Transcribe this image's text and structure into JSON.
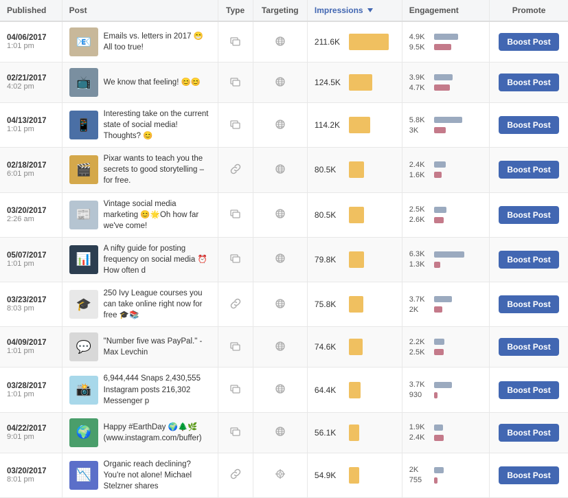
{
  "columns": {
    "published": "Published",
    "post": "Post",
    "type": "Type",
    "targeting": "Targeting",
    "impressions": "Impressions",
    "engagement": "Engagement",
    "promote": "Promote"
  },
  "boost_label": "Boost Post",
  "rows": [
    {
      "date": "04/06/2017",
      "time": "1:01 pm",
      "post_text": "Emails vs. letters in 2017 😁All too true!",
      "type": "post",
      "targeting": "public",
      "impressions_value": "211.6K",
      "impressions_pct": 100,
      "eng1_val": "4.9K",
      "eng1_pct": 78,
      "eng2_val": "9.5K",
      "eng2_pct": 55,
      "thumb_color": "#c8b89a",
      "thumb_emoji": "📧"
    },
    {
      "date": "02/21/2017",
      "time": "4:02 pm",
      "post_text": "We know that feeling! 😊😊",
      "type": "post",
      "targeting": "public",
      "impressions_value": "124.5K",
      "impressions_pct": 59,
      "eng1_val": "3.9K",
      "eng1_pct": 60,
      "eng2_val": "4.7K",
      "eng2_pct": 50,
      "thumb_color": "#7a8fa0",
      "thumb_emoji": "📺"
    },
    {
      "date": "04/13/2017",
      "time": "1:01 pm",
      "post_text": "Interesting take on the current state of social media! Thoughts? 😊",
      "type": "post",
      "targeting": "public",
      "impressions_value": "114.2K",
      "impressions_pct": 54,
      "eng1_val": "5.8K",
      "eng1_pct": 90,
      "eng2_val": "3K",
      "eng2_pct": 38,
      "thumb_color": "#4a6fa5",
      "thumb_emoji": "📱"
    },
    {
      "date": "02/18/2017",
      "time": "6:01 pm",
      "post_text": "Pixar wants to teach you the secrets to good storytelling – for free.",
      "type": "link",
      "targeting": "public",
      "impressions_value": "80.5K",
      "impressions_pct": 38,
      "eng1_val": "2.4K",
      "eng1_pct": 37,
      "eng2_val": "1.6K",
      "eng2_pct": 25,
      "thumb_color": "#d4a84b",
      "thumb_emoji": "🎬"
    },
    {
      "date": "03/20/2017",
      "time": "2:26 am",
      "post_text": "Vintage social media marketing 😊🌟Oh how far we've come!",
      "type": "post",
      "targeting": "public",
      "impressions_value": "80.5K",
      "impressions_pct": 38,
      "eng1_val": "2.5K",
      "eng1_pct": 39,
      "eng2_val": "2.6K",
      "eng2_pct": 32,
      "thumb_color": "#b5c4d1",
      "thumb_emoji": "📰"
    },
    {
      "date": "05/07/2017",
      "time": "1:01 pm",
      "post_text": "A nifty guide for posting frequency on social media ⏰How often d",
      "type": "post",
      "targeting": "public",
      "impressions_value": "79.8K",
      "impressions_pct": 38,
      "eng1_val": "6.3K",
      "eng1_pct": 98,
      "eng2_val": "1.3K",
      "eng2_pct": 20,
      "thumb_color": "#2c3e50",
      "thumb_emoji": "📊"
    },
    {
      "date": "03/23/2017",
      "time": "8:03 pm",
      "post_text": "250 Ivy League courses you can take online right now for free 🎓📚",
      "type": "link",
      "targeting": "public",
      "impressions_value": "75.8K",
      "impressions_pct": 36,
      "eng1_val": "3.7K",
      "eng1_pct": 57,
      "eng2_val": "2K",
      "eng2_pct": 27,
      "thumb_color": "#e8e8e8",
      "thumb_emoji": "🎓"
    },
    {
      "date": "04/09/2017",
      "time": "1:01 pm",
      "post_text": "\"Number five was PayPal.\" - Max Levchin",
      "type": "post",
      "targeting": "public",
      "impressions_value": "74.6K",
      "impressions_pct": 35,
      "eng1_val": "2.2K",
      "eng1_pct": 34,
      "eng2_val": "2.5K",
      "eng2_pct": 31,
      "thumb_color": "#d8d8d8",
      "thumb_emoji": "💬"
    },
    {
      "date": "03/28/2017",
      "time": "1:01 pm",
      "post_text": "6,944,444 Snaps 2,430,555 Instagram posts 216,302 Messenger p",
      "type": "post",
      "targeting": "public",
      "impressions_value": "64.4K",
      "impressions_pct": 30,
      "eng1_val": "3.7K",
      "eng1_pct": 57,
      "eng2_val": "930",
      "eng2_pct": 12,
      "thumb_color": "#a8d8ea",
      "thumb_emoji": "📸"
    },
    {
      "date": "04/22/2017",
      "time": "9:01 pm",
      "post_text": "Happy #EarthDay 🌍🌲🌿 (www.instagram.com/buffer)",
      "type": "post",
      "targeting": "public",
      "impressions_value": "56.1K",
      "impressions_pct": 26,
      "eng1_val": "1.9K",
      "eng1_pct": 29,
      "eng2_val": "2.4K",
      "eng2_pct": 30,
      "thumb_color": "#4a9e6b",
      "thumb_emoji": "🌍"
    },
    {
      "date": "03/20/2017",
      "time": "8:01 pm",
      "post_text": "Organic reach declining? You're not alone! Michael Stelzner shares",
      "type": "link",
      "targeting": "crosshair",
      "impressions_value": "54.9K",
      "impressions_pct": 26,
      "eng1_val": "2K",
      "eng1_pct": 31,
      "eng2_val": "755",
      "eng2_pct": 10,
      "thumb_color": "#5b6fc9",
      "thumb_emoji": "📉"
    }
  ]
}
